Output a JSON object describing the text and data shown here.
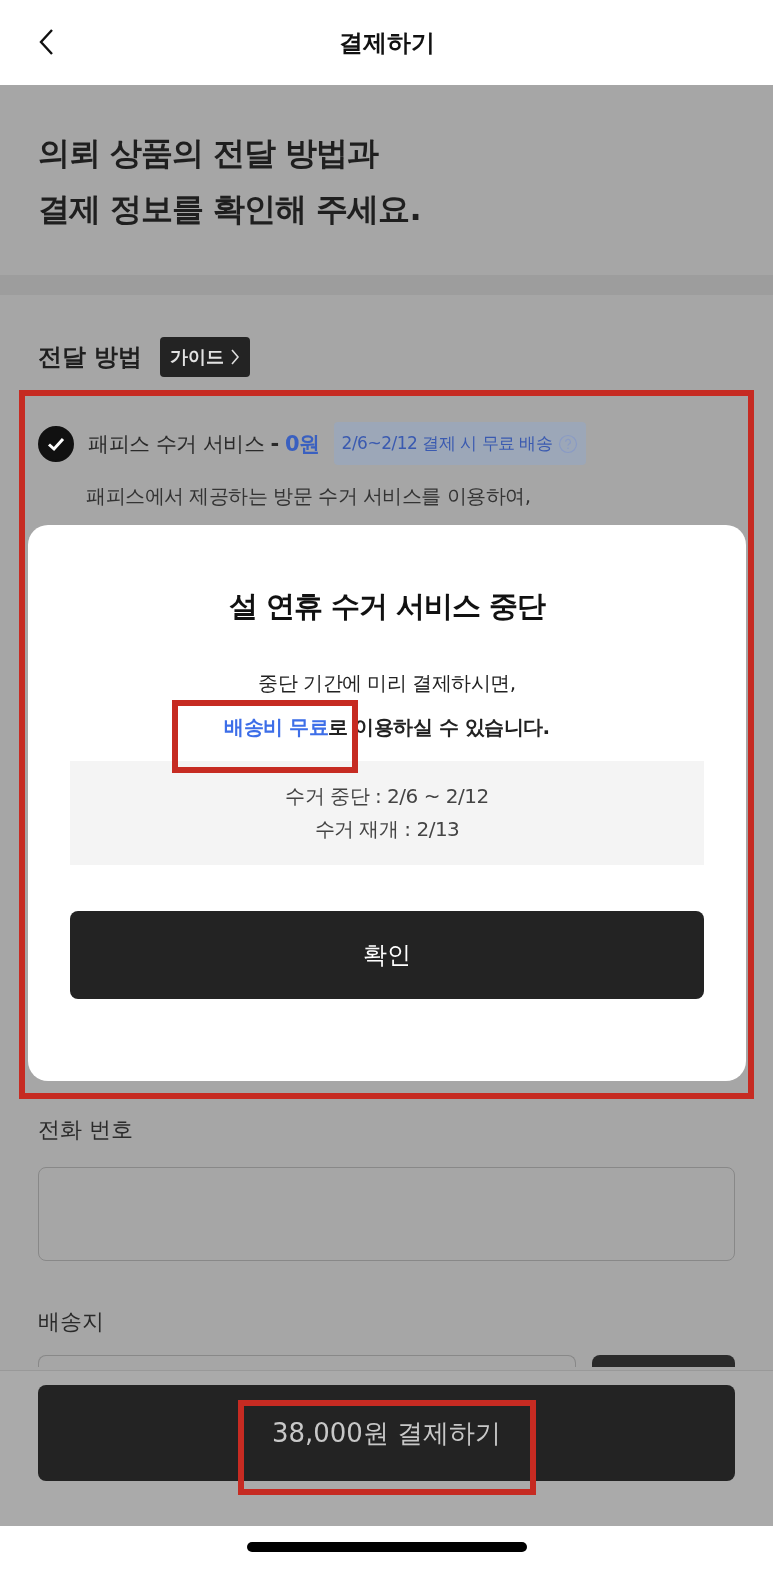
{
  "header": {
    "title": "결제하기"
  },
  "intro": {
    "lines": [
      "의뢰 상품의 전달 방법과",
      "결제 정보를 확인해 주세요."
    ]
  },
  "delivery": {
    "title": "전달 방법",
    "guide_button": "가이드",
    "options": [
      {
        "name": "패피스 수거 서비스",
        "separator": "-",
        "price": "0원",
        "tag": "2/6~2/12 결제 시 무료 배송",
        "description": "패피스에서 제공하는 방문 수거 서비스를 이용하여,",
        "selected": true
      }
    ]
  },
  "form": {
    "phone": {
      "label": "전화 번호"
    },
    "address": {
      "label": "배송지"
    }
  },
  "pay_button": "38,000원 결제하기",
  "modal": {
    "title": "설 연휴 수거 서비스 중단",
    "message": {
      "line_1": "중단 기간에 미리 결제하시면,",
      "highlight": "배송비 무료",
      "line_2_rest": "로 이용하실 수 있습니다."
    },
    "info": [
      "수거 중단 : 2/6 ~ 2/12",
      "수거 재개 : 2/13"
    ],
    "confirm_button": "확인"
  }
}
